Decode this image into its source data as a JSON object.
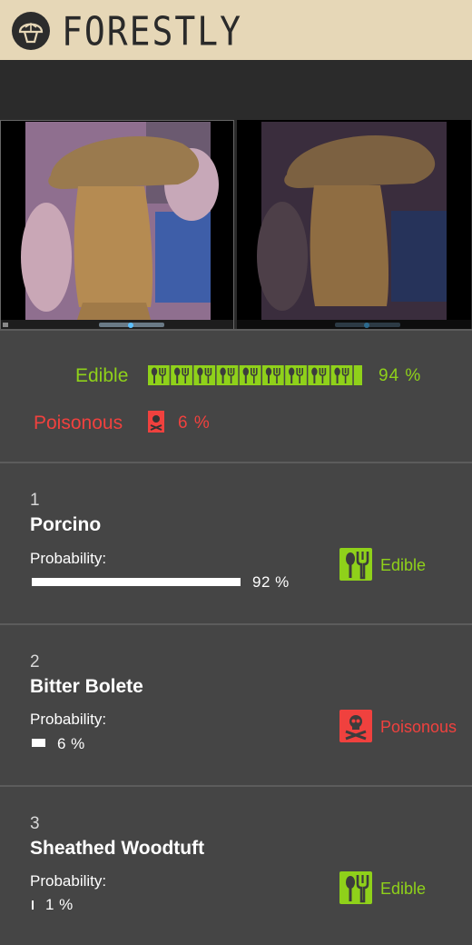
{
  "header": {
    "brand": "FORESTLY"
  },
  "summary": {
    "edible_label": "Edible",
    "edible_pct": "94 %",
    "edible_value": 94,
    "poisonous_label": "Poisonous",
    "poisonous_pct": "6 %",
    "poisonous_value": 6
  },
  "colors": {
    "edible": "#8fd11a",
    "poisonous": "#f0413e",
    "header_bg": "#e6d7b7"
  },
  "results": [
    {
      "rank": "1",
      "name": "Porcino",
      "prob_label": "Probability:",
      "prob": "92 %",
      "prob_value": 92,
      "status": "Edible",
      "icon": "fork-spoon-icon"
    },
    {
      "rank": "2",
      "name": "Bitter Bolete",
      "prob_label": "Probability:",
      "prob": "6 %",
      "prob_value": 6,
      "status": "Poisonous",
      "icon": "skull-icon"
    },
    {
      "rank": "3",
      "name": "Sheathed Woodtuft",
      "prob_label": "Probability:",
      "prob": "1 %",
      "prob_value": 1,
      "status": "Edible",
      "icon": "fork-spoon-icon"
    }
  ]
}
